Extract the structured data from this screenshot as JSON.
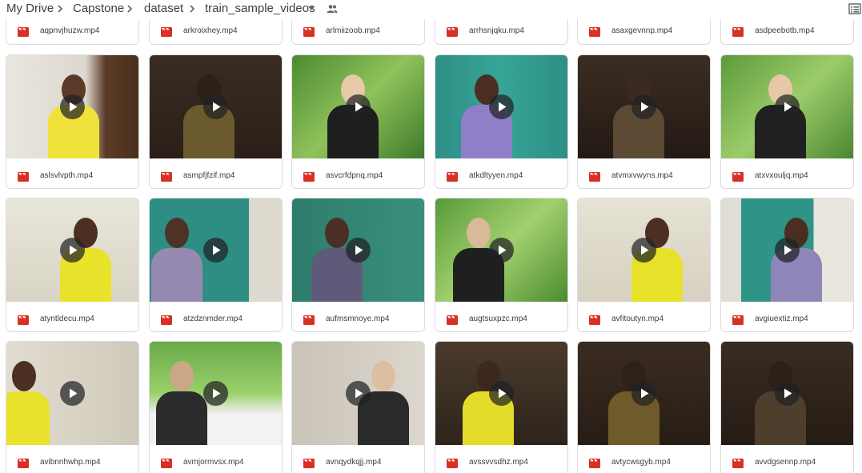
{
  "breadcrumb": {
    "items": [
      "My Drive",
      "Capstone",
      "dataset",
      "train_sample_videos"
    ],
    "dropdown_icon": "triangle-down-icon",
    "shared_icon": "people-icon"
  },
  "view_toggle_icon": "list-view-icon",
  "colors": {
    "video_icon": "#d93025",
    "border": "#dadce0",
    "text": "#3c4043",
    "play_overlay": "#202124"
  },
  "top_row_files": [
    "aqpnvjhuzw.mp4",
    "arkroixhey.mp4",
    "arlmiizoob.mp4",
    "arrhsnjqku.mp4",
    "asaxgevnnp.mp4",
    "asdpeebotb.mp4"
  ],
  "rows": [
    [
      "aslsvlvpth.mp4",
      "asmpfjfzif.mp4",
      "asvcrfdpnq.mp4",
      "atkdltyyen.mp4",
      "atvmxvwyns.mp4",
      "atxvxouljq.mp4"
    ],
    [
      "atyntldecu.mp4",
      "atzdznmder.mp4",
      "aufmsmnoye.mp4",
      "augtsuxpzc.mp4",
      "avfitoutyn.mp4",
      "avgiuextiz.mp4"
    ],
    [
      "avibnnhwhp.mp4",
      "avmjormvsx.mp4",
      "avnqydkqjj.mp4",
      "avssvvsdhz.mp4",
      "avtycwsgyb.mp4",
      "avvdgsennp.mp4"
    ]
  ]
}
